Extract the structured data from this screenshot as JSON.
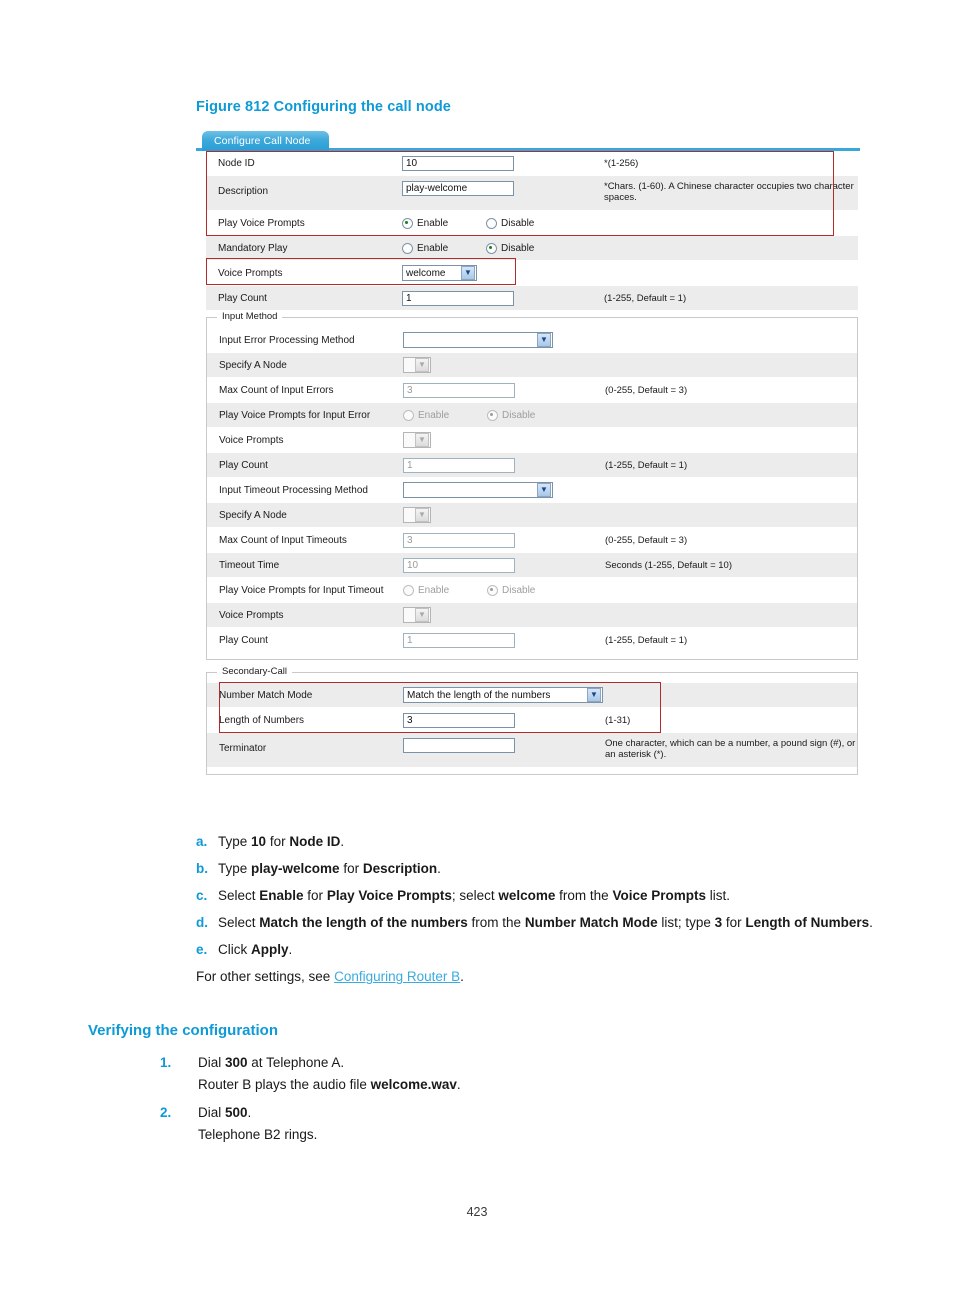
{
  "figure": {
    "caption": "Figure 812 Configuring the call node"
  },
  "screenshot": {
    "tab_label": "Configure Call Node",
    "main_rows": [
      {
        "label": "Node ID",
        "value": "10",
        "hint": "*(1-256)"
      },
      {
        "label": "Description",
        "value": "play-welcome",
        "hint": "*Chars. (1-60). A Chinese character occupies two character spaces."
      },
      {
        "label": "Play Voice Prompts",
        "enable": "Enable",
        "disable": "Disable",
        "selected": "Enable"
      },
      {
        "label": "Mandatory Play",
        "enable": "Enable",
        "disable": "Disable",
        "selected": "Disable"
      },
      {
        "label": "Voice Prompts",
        "value": "welcome"
      },
      {
        "label": "Play Count",
        "value": "1",
        "hint": "(1-255, Default = 1)"
      }
    ],
    "input_method": {
      "legend": "Input Method",
      "rows": [
        {
          "label": "Input Error Processing Method",
          "value": ""
        },
        {
          "label": "Specify A Node",
          "value": ""
        },
        {
          "label": "Max Count of Input Errors",
          "value": "3",
          "hint": "(0-255, Default = 3)"
        },
        {
          "label": "Play Voice Prompts for Input Error",
          "enable": "Enable",
          "disable": "Disable",
          "selected": "Disable"
        },
        {
          "label": "Voice Prompts",
          "value": ""
        },
        {
          "label": "Play Count",
          "value": "1",
          "hint": "(1-255, Default = 1)"
        },
        {
          "label": "Input Timeout Processing Method",
          "value": ""
        },
        {
          "label": "Specify A Node",
          "value": ""
        },
        {
          "label": "Max Count of Input Timeouts",
          "value": "3",
          "hint": "(0-255, Default = 3)"
        },
        {
          "label": "Timeout Time",
          "value": "10",
          "hint": "Seconds (1-255, Default = 10)"
        },
        {
          "label": "Play Voice Prompts for Input Timeout",
          "enable": "Enable",
          "disable": "Disable",
          "selected": "Disable"
        },
        {
          "label": "Voice Prompts",
          "value": ""
        },
        {
          "label": "Play Count",
          "value": "1",
          "hint": "(1-255, Default = 1)"
        }
      ]
    },
    "secondary_call": {
      "legend": "Secondary-Call",
      "rows": [
        {
          "label": "Number Match Mode",
          "value": "Match the length of the numbers"
        },
        {
          "label": "Length of Numbers",
          "value": "3",
          "hint": "(1-31)"
        },
        {
          "label": "Terminator",
          "value": "",
          "hint": "One character, which can be a number, a pound sign (#), or an asterisk (*)."
        }
      ]
    }
  },
  "steps": [
    {
      "marker": "a.",
      "html": "Type <b>10</b> for <b>Node ID</b>."
    },
    {
      "marker": "b.",
      "html": "Type <b>play-welcome</b> for <b>Description</b>."
    },
    {
      "marker": "c.",
      "html": "Select <b>Enable</b> for <b>Play Voice Prompts</b>; select <b>welcome</b> from the <b>Voice Prompts</b> list."
    },
    {
      "marker": "d.",
      "html": "Select <b>Match the length of the numbers</b> from the <b>Number Match Mode</b> list; type <b>3</b> for <b>Length of Numbers</b>."
    },
    {
      "marker": "e.",
      "html": "Click <b>Apply</b>."
    }
  ],
  "other_settings": {
    "prefix": "For other settings, see ",
    "link": "Configuring Router B",
    "suffix": "."
  },
  "verify": {
    "heading": "Verifying the configuration",
    "items": [
      {
        "marker": "1.",
        "html": "Dial <b>300</b> at Telephone A.",
        "sub": "Router B plays the audio file <b>welcome.wav</b>."
      },
      {
        "marker": "2.",
        "html": "Dial <b>500</b>.",
        "sub": "Telephone B2 rings."
      }
    ]
  },
  "footer": {
    "page_number": "423"
  },
  "colors": {
    "accent_blue": "#0d9ad7",
    "link_blue": "#3aabdf",
    "highlight_red": "#b32a2a",
    "tab_blue": "#2b9ed6"
  }
}
